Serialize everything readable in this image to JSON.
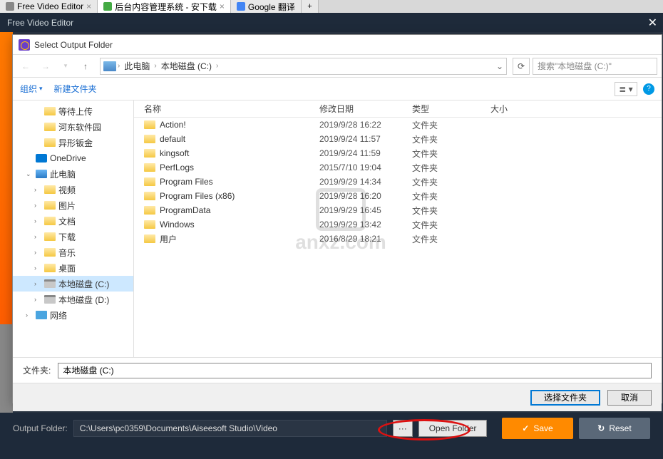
{
  "browser_tabs": [
    {
      "label": "Free Video Editor",
      "active": false
    },
    {
      "label": "后台内容管理系统 - 安下载",
      "active": true
    },
    {
      "label": "Google 翻译",
      "active": false
    }
  ],
  "app": {
    "title": "Free Video Editor"
  },
  "dialog": {
    "title": "Select Output Folder",
    "breadcrumb": {
      "root": "此电脑",
      "path": "本地磁盘 (C:)"
    },
    "search_placeholder": "搜索\"本地磁盘 (C:)\"",
    "toolbar": {
      "organize": "组织",
      "newfolder": "新建文件夹"
    },
    "columns": {
      "name": "名称",
      "date": "修改日期",
      "type": "类型",
      "size": "大小"
    },
    "tree": [
      {
        "label": "等待上传",
        "icon": "folder",
        "level": 1
      },
      {
        "label": "河东软件园",
        "icon": "folder",
        "level": 1
      },
      {
        "label": "异形钣金",
        "icon": "folder",
        "level": 1
      },
      {
        "label": "OneDrive",
        "icon": "onedrive",
        "level": 0,
        "exp": ""
      },
      {
        "label": "此电脑",
        "icon": "pc",
        "level": 0,
        "exp": "v"
      },
      {
        "label": "视频",
        "icon": "folder",
        "level": 1,
        "exp": ">"
      },
      {
        "label": "图片",
        "icon": "folder",
        "level": 1,
        "exp": ">"
      },
      {
        "label": "文档",
        "icon": "folder",
        "level": 1,
        "exp": ">"
      },
      {
        "label": "下载",
        "icon": "folder",
        "level": 1,
        "exp": ">"
      },
      {
        "label": "音乐",
        "icon": "folder",
        "level": 1,
        "exp": ">"
      },
      {
        "label": "桌面",
        "icon": "folder",
        "level": 1,
        "exp": ">"
      },
      {
        "label": "本地磁盘 (C:)",
        "icon": "drive",
        "level": 1,
        "exp": ">",
        "selected": true
      },
      {
        "label": "本地磁盘 (D:)",
        "icon": "drive",
        "level": 1,
        "exp": ">"
      },
      {
        "label": "网络",
        "icon": "net",
        "level": 0,
        "exp": ">"
      }
    ],
    "files": [
      {
        "name": "Action!",
        "date": "2019/9/28 16:22",
        "type": "文件夹"
      },
      {
        "name": "default",
        "date": "2019/9/24 11:57",
        "type": "文件夹"
      },
      {
        "name": "kingsoft",
        "date": "2019/9/24 11:59",
        "type": "文件夹"
      },
      {
        "name": "PerfLogs",
        "date": "2015/7/10 19:04",
        "type": "文件夹"
      },
      {
        "name": "Program Files",
        "date": "2019/9/29 14:34",
        "type": "文件夹"
      },
      {
        "name": "Program Files (x86)",
        "date": "2019/9/28 16:20",
        "type": "文件夹"
      },
      {
        "name": "ProgramData",
        "date": "2019/9/29 16:45",
        "type": "文件夹"
      },
      {
        "name": "Windows",
        "date": "2019/9/29 13:42",
        "type": "文件夹"
      },
      {
        "name": "用户",
        "date": "2016/8/29 18:21",
        "type": "文件夹"
      }
    ],
    "filename_label": "文件夹:",
    "filename_value": "本地磁盘 (C:)",
    "buttons": {
      "select": "选择文件夹",
      "cancel": "取消"
    }
  },
  "bottom": {
    "label": "Output Folder:",
    "path": "C:\\Users\\pc0359\\Documents\\Aiseesoft Studio\\Video",
    "open": "Open Folder",
    "save": "Save",
    "reset": "Reset"
  },
  "watermark": "anxz.com"
}
